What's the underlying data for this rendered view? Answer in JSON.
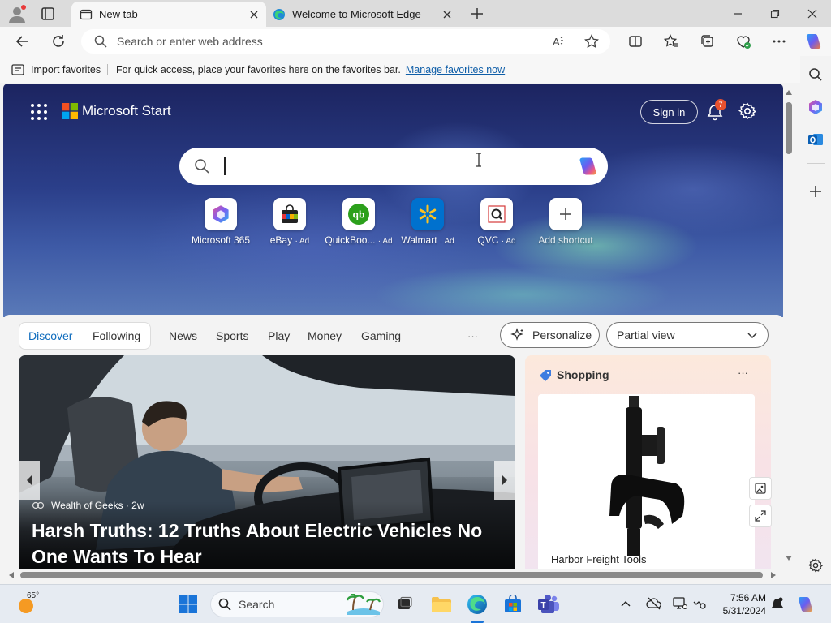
{
  "browser": {
    "tabs": [
      {
        "label": "New tab",
        "active": true
      },
      {
        "label": "Welcome to Microsoft Edge",
        "active": false
      }
    ],
    "address_placeholder": "Search or enter web address"
  },
  "favorites_bar": {
    "import_label": "Import favorites",
    "hint_text": "For quick access, place your favorites here on the favorites bar.",
    "manage_link": "Manage favorites now"
  },
  "start_page": {
    "brand": "Microsoft Start",
    "sign_in": "Sign in",
    "notification_count": "7",
    "shortcuts": [
      {
        "label": "Microsoft 365",
        "ad": ""
      },
      {
        "label": "eBay",
        "ad": "· Ad"
      },
      {
        "label": "QuickBoo...",
        "ad": "· Ad"
      },
      {
        "label": "Walmart",
        "ad": "· Ad"
      },
      {
        "label": "QVC",
        "ad": "· Ad"
      },
      {
        "label": "Add shortcut",
        "ad": ""
      }
    ],
    "feed_tabs": {
      "discover": "Discover",
      "following": "Following",
      "news": "News",
      "sports": "Sports",
      "play": "Play",
      "money": "Money",
      "gaming": "Gaming",
      "more": "···"
    },
    "personalize": "Personalize",
    "view_select": "Partial view",
    "hero_story": {
      "source": "Wealth of Geeks · 2w",
      "headline": "Harsh Truths: 12 Truths About Electric Vehicles No One Wants To Hear"
    },
    "shopping": {
      "title": "Shopping",
      "more": "···",
      "product_brand": "Harbor Freight Tools"
    }
  },
  "taskbar": {
    "weather": "65°",
    "search": "Search",
    "time": "7:56 AM",
    "date": "5/31/2024"
  },
  "colors": {
    "accent": "#0f6cbd",
    "notification_badge": "#e8512f",
    "taskbar_bg": "#e6ebf2"
  }
}
